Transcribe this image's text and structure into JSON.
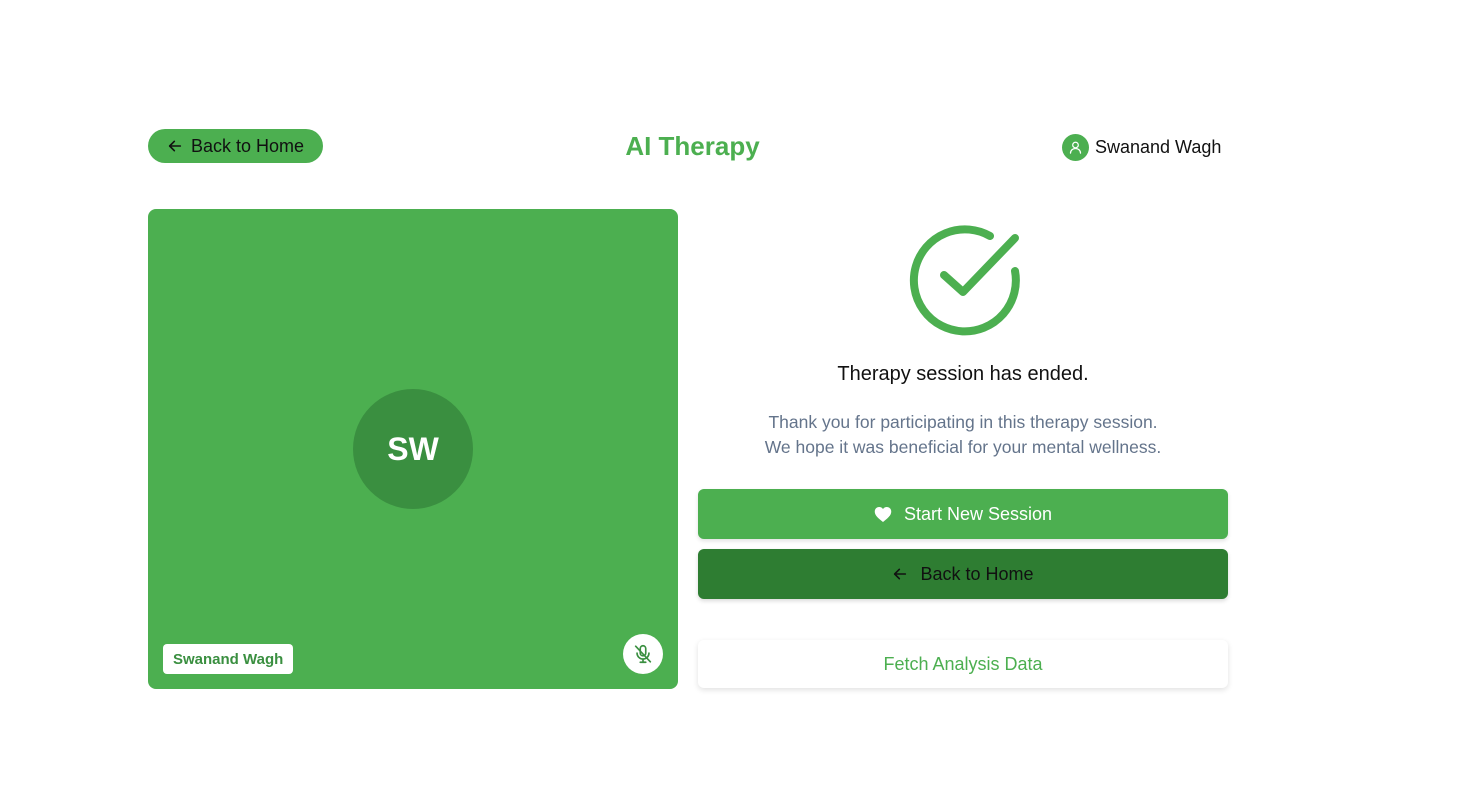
{
  "header": {
    "back_label": "Back to Home",
    "title": "AI Therapy",
    "user_name": "Swanand Wagh"
  },
  "video_tile": {
    "initials": "SW",
    "participant_name": "Swanand Wagh",
    "mic_state": "muted"
  },
  "session_end": {
    "title": "Therapy session has ended.",
    "message_line1": "Thank you for participating in this therapy session.",
    "message_line2": "We hope it was beneficial for your mental wellness.",
    "start_new_label": "Start New Session",
    "back_home_label": "Back to Home",
    "fetch_label": "Fetch Analysis Data"
  },
  "icons": {
    "back": "arrow-left-icon",
    "user": "user-icon",
    "mic": "mic-off-icon",
    "success": "check-circle-icon",
    "heart": "heart-icon"
  },
  "colors": {
    "primary": "#4caf50",
    "primary_dark": "#2e7d32",
    "avatar_dark": "#3a8f40",
    "muted_text": "#64748b"
  }
}
